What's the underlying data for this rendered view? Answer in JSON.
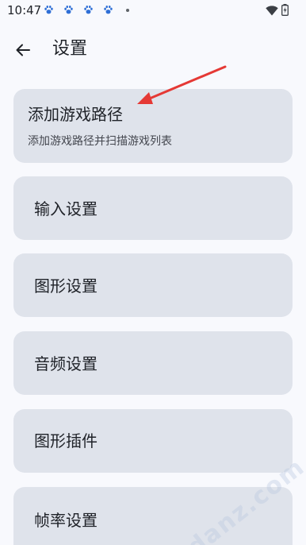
{
  "status_bar": {
    "time": "10:47",
    "notification_icons": [
      "paw-icon",
      "paw-icon",
      "paw-icon",
      "paw-icon"
    ],
    "more_indicator": "dot-icon",
    "wifi": "wifi-icon",
    "battery": "battery-charging-icon"
  },
  "app_bar": {
    "back_icon": "arrow-left-icon",
    "title": "设置"
  },
  "settings": {
    "items": [
      {
        "title": "添加游戏路径",
        "subtitle": "添加游戏路径并扫描游戏列表"
      },
      {
        "title": "输入设置"
      },
      {
        "title": "图形设置"
      },
      {
        "title": "音频设置"
      },
      {
        "title": "图形插件"
      },
      {
        "title": "帧率设置"
      }
    ]
  },
  "annotation": {
    "arrow_color": "#e53935"
  },
  "watermark": {
    "text": "danz.com"
  },
  "colors": {
    "background": "#f8f9fd",
    "card": "#dfe3eb",
    "text_primary": "#1f2228",
    "text_secondary": "#44474f",
    "paw_icon": "#2f6fd6"
  }
}
